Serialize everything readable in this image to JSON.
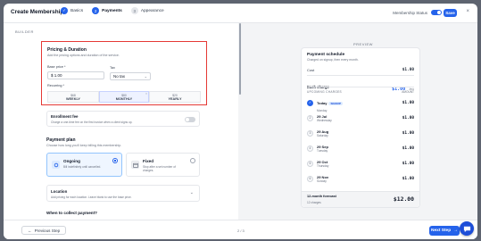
{
  "header": {
    "title": "Create Membership",
    "steps": [
      {
        "label": "Basics",
        "state": "done",
        "num": "✓"
      },
      {
        "label": "Payments",
        "state": "active",
        "num": "2"
      },
      {
        "label": "Appearance",
        "state": "todo",
        "num": "3"
      }
    ],
    "status_label": "Membership Status",
    "save_label": "Save",
    "close_icon": "×"
  },
  "builder": {
    "section_label": "BUILDER",
    "pricing": {
      "title": "Pricing & Duration",
      "subtitle": "Add the pricing options and duration of the service.",
      "base_price_label": "Base price *",
      "base_price_value": "$ 1.00",
      "tax_label": "Tax",
      "tax_value": "No tax",
      "recurring_label": "Recurring *",
      "options": [
        {
          "price": "$68",
          "name": "WEEKLY",
          "active": false
        },
        {
          "price": "$80",
          "name": "MONTHLY",
          "active": true
        },
        {
          "price": "$20",
          "name": "YEARLY",
          "active": false
        }
      ]
    },
    "enrollment": {
      "title": "Enrollment fee",
      "subtitle": "Charge a one-time fee on the first invoice when a client signs up."
    },
    "payment_plan": {
      "title": "Payment plan",
      "subtitle": "Choose how long you'll keep billing this membership.",
      "ongoing_title": "Ongoing",
      "ongoing_sub": "Bill indefinitely until cancelled.",
      "fixed_title": "Fixed",
      "fixed_sub": "Stop after a set number of charges."
    },
    "location": {
      "title": "Location",
      "subtitle": "Add pricing for each location. Leave blank to use the base price."
    },
    "when_collect": "When to collect payment?"
  },
  "preview": {
    "section_label": "PREVIEW",
    "schedule_title": "Payment schedule",
    "schedule_sub": "Charged on signup, then every month.",
    "cost_label": "Cost",
    "cost_value": "$1.00",
    "each_charge_label": "Each charge",
    "each_charge_value": "$1.00",
    "each_charge_unit": "/mo",
    "upcoming_label": "UPCOMING CHARGES",
    "upcoming_count": "AMOUNT",
    "payments": [
      {
        "num": "✓",
        "date": "Today",
        "day": "Monday",
        "amount": "$1.00",
        "today": true,
        "badge": "SIGNUP"
      },
      {
        "num": "2",
        "date": "29 Jul",
        "day": "Wednesday",
        "amount": "$1.00",
        "today": false,
        "badge": ""
      },
      {
        "num": "3",
        "date": "29 Aug",
        "day": "Saturday",
        "amount": "$1.00",
        "today": false,
        "badge": ""
      },
      {
        "num": "4",
        "date": "29 Sep",
        "day": "Tuesday",
        "amount": "$1.00",
        "today": false,
        "badge": ""
      },
      {
        "num": "5",
        "date": "29 Oct",
        "day": "Thursday",
        "amount": "$1.00",
        "today": false,
        "badge": ""
      },
      {
        "num": "6",
        "date": "29 Nov",
        "day": "Sunday",
        "amount": "$1.00",
        "today": false,
        "badge": ""
      }
    ],
    "forecast_label": "12-month forecast",
    "forecast_sub": "12 charges",
    "forecast_value": "$12.00"
  },
  "footer": {
    "prev_label": "Previous Step",
    "page_indicator": "2 / 3",
    "next_label": "Next Step"
  },
  "colors": {
    "accent": "#2563eb",
    "highlight_border": "#e53935"
  }
}
